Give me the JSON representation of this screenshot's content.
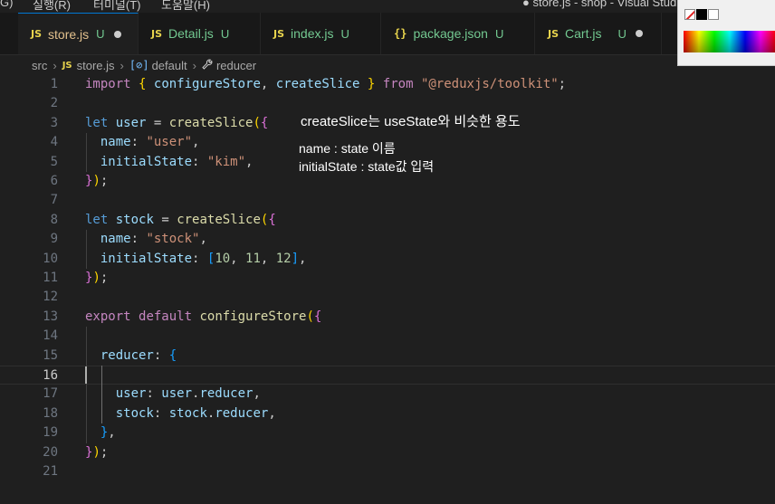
{
  "menubar": {
    "items": [
      "G)",
      "실행(R)",
      "터미널(T)",
      "도움말(H)"
    ],
    "window_title": "● store.js - shop - Visual Studi"
  },
  "tabs": [
    {
      "icon": "JS",
      "label": "store.js",
      "status": "U",
      "modified": true,
      "active": true
    },
    {
      "icon": "JS",
      "label": "Detail.js",
      "status": "U",
      "modified": false,
      "active": false
    },
    {
      "icon": "JS",
      "label": "index.js",
      "status": "U",
      "modified": false,
      "active": false
    },
    {
      "icon": "{}",
      "label": "package.json",
      "status": "U",
      "modified": false,
      "active": false
    },
    {
      "icon": "JS",
      "label": "Cart.js",
      "status": "U",
      "modified": true,
      "active": false
    }
  ],
  "breadcrumb": {
    "folder": "src",
    "file_icon": "JS",
    "file": "store.js",
    "symbol_icon": "[⊘]",
    "symbol": "default",
    "property": "reducer"
  },
  "editor": {
    "current_line": 16,
    "lines": [
      {
        "n": "1",
        "tokens": [
          [
            "kw2",
            "import"
          ],
          [
            "pl",
            " "
          ],
          [
            "br1",
            "{"
          ],
          [
            "pl",
            " "
          ],
          [
            "var",
            "configureStore"
          ],
          [
            "pl",
            ", "
          ],
          [
            "var",
            "createSlice"
          ],
          [
            "pl",
            " "
          ],
          [
            "br1",
            "}"
          ],
          [
            "pl",
            " "
          ],
          [
            "kw2",
            "from"
          ],
          [
            "pl",
            " "
          ],
          [
            "str",
            "\"@reduxjs/toolkit\""
          ],
          [
            "pl",
            ";"
          ]
        ]
      },
      {
        "n": "2",
        "tokens": []
      },
      {
        "n": "3",
        "tokens": [
          [
            "kw",
            "let"
          ],
          [
            "pl",
            " "
          ],
          [
            "var",
            "user"
          ],
          [
            "pl",
            " = "
          ],
          [
            "fn",
            "createSlice"
          ],
          [
            "br1",
            "("
          ],
          [
            "br2",
            "{"
          ]
        ]
      },
      {
        "n": "4",
        "tokens": [
          [
            "pl",
            "  "
          ],
          [
            "var",
            "name"
          ],
          [
            "pl",
            ": "
          ],
          [
            "str",
            "\"user\""
          ],
          [
            "pl",
            ","
          ]
        ]
      },
      {
        "n": "5",
        "tokens": [
          [
            "pl",
            "  "
          ],
          [
            "var",
            "initialState"
          ],
          [
            "pl",
            ": "
          ],
          [
            "str",
            "\"kim\""
          ],
          [
            "pl",
            ","
          ]
        ]
      },
      {
        "n": "6",
        "tokens": [
          [
            "br2",
            "}"
          ],
          [
            "br1",
            ")"
          ],
          [
            "pl",
            ";"
          ]
        ]
      },
      {
        "n": "7",
        "tokens": []
      },
      {
        "n": "8",
        "tokens": [
          [
            "kw",
            "let"
          ],
          [
            "pl",
            " "
          ],
          [
            "var",
            "stock"
          ],
          [
            "pl",
            " = "
          ],
          [
            "fn",
            "createSlice"
          ],
          [
            "br1",
            "("
          ],
          [
            "br2",
            "{"
          ]
        ]
      },
      {
        "n": "9",
        "tokens": [
          [
            "pl",
            "  "
          ],
          [
            "var",
            "name"
          ],
          [
            "pl",
            ": "
          ],
          [
            "str",
            "\"stock\""
          ],
          [
            "pl",
            ","
          ]
        ]
      },
      {
        "n": "10",
        "tokens": [
          [
            "pl",
            "  "
          ],
          [
            "var",
            "initialState"
          ],
          [
            "pl",
            ": "
          ],
          [
            "br3",
            "["
          ],
          [
            "num",
            "10"
          ],
          [
            "pl",
            ", "
          ],
          [
            "num",
            "11"
          ],
          [
            "pl",
            ", "
          ],
          [
            "num",
            "12"
          ],
          [
            "br3",
            "]"
          ],
          [
            "pl",
            ","
          ]
        ]
      },
      {
        "n": "11",
        "tokens": [
          [
            "br2",
            "}"
          ],
          [
            "br1",
            ")"
          ],
          [
            "pl",
            ";"
          ]
        ]
      },
      {
        "n": "12",
        "tokens": []
      },
      {
        "n": "13",
        "tokens": [
          [
            "kw2",
            "export"
          ],
          [
            "pl",
            " "
          ],
          [
            "kw2",
            "default"
          ],
          [
            "pl",
            " "
          ],
          [
            "fn",
            "configureStore"
          ],
          [
            "br1",
            "("
          ],
          [
            "br2",
            "{"
          ]
        ]
      },
      {
        "n": "14",
        "tokens": []
      },
      {
        "n": "15",
        "tokens": [
          [
            "pl",
            "  "
          ],
          [
            "var",
            "reducer"
          ],
          [
            "pl",
            ": "
          ],
          [
            "br3",
            "{"
          ]
        ]
      },
      {
        "n": "16",
        "tokens": []
      },
      {
        "n": "17",
        "tokens": [
          [
            "pl",
            "    "
          ],
          [
            "var",
            "user"
          ],
          [
            "pl",
            ": "
          ],
          [
            "var",
            "user"
          ],
          [
            "pl",
            "."
          ],
          [
            "var",
            "reducer"
          ],
          [
            "pl",
            ","
          ]
        ]
      },
      {
        "n": "18",
        "tokens": [
          [
            "pl",
            "    "
          ],
          [
            "var",
            "stock"
          ],
          [
            "pl",
            ": "
          ],
          [
            "var",
            "stock"
          ],
          [
            "pl",
            "."
          ],
          [
            "var",
            "reducer"
          ],
          [
            "pl",
            ","
          ]
        ]
      },
      {
        "n": "19",
        "tokens": [
          [
            "pl",
            "  "
          ],
          [
            "br3",
            "}"
          ],
          [
            "pl",
            ","
          ]
        ]
      },
      {
        "n": "20",
        "tokens": [
          [
            "br2",
            "}"
          ],
          [
            "br1",
            ")"
          ],
          [
            "pl",
            ";"
          ]
        ]
      },
      {
        "n": "21",
        "tokens": []
      }
    ]
  },
  "annotations": {
    "title": "createSlice는 useState와 비슷한 용도",
    "line1": "name : state 이름",
    "line2": "initialState : state값 입력"
  },
  "colors": {
    "accent": "#0078d4",
    "background": "#1f1f1f"
  }
}
